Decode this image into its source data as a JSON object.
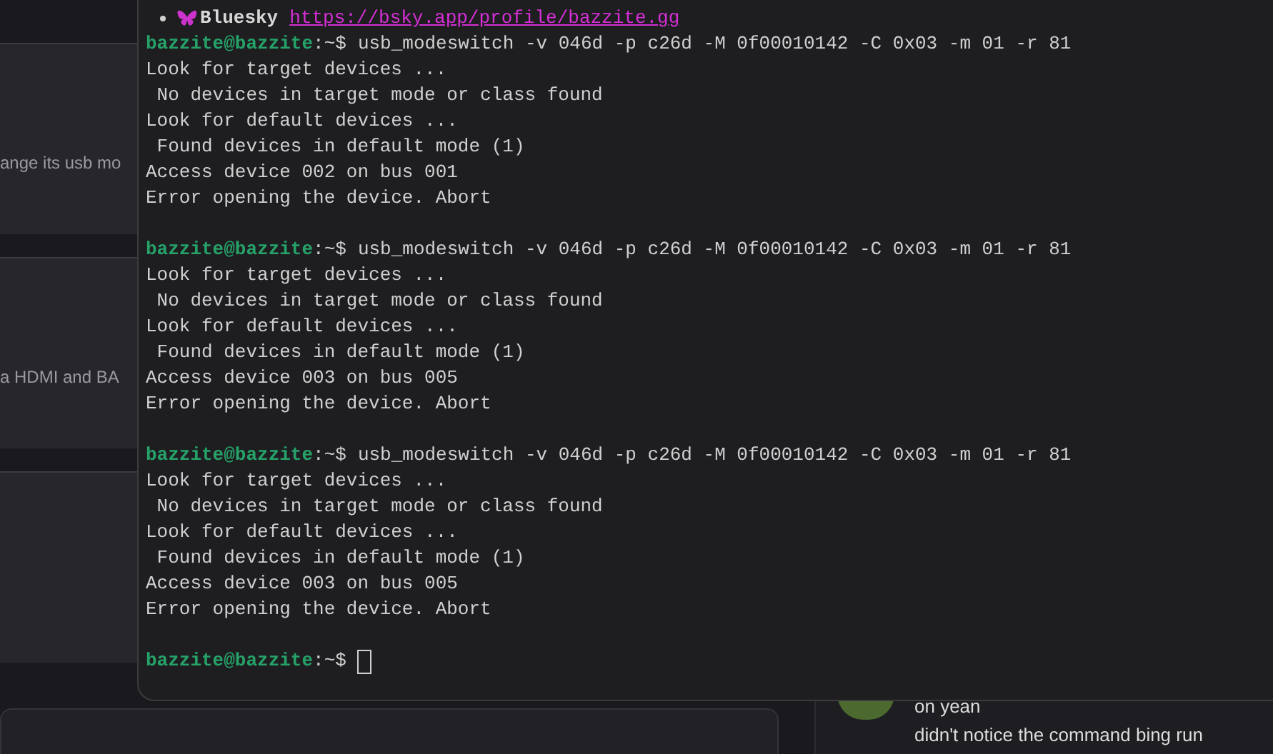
{
  "background_posts": [
    {
      "snippet": "ange its usb mo"
    },
    {
      "snippet": "a HDMI and BA"
    }
  ],
  "terminal": {
    "lines": [
      {
        "kind": "link_item",
        "label": "Bluesky",
        "url": "https://bsky.app/profile/bazzite.gg"
      },
      {
        "kind": "prompt",
        "user": "bazzite@bazzite",
        "path": ":~$",
        "command": "usb_modeswitch -v 046d -p c26d -M 0f00010142 -C 0x03 -m 01 -r 81"
      },
      {
        "kind": "output",
        "text": "Look for target devices ..."
      },
      {
        "kind": "output",
        "text": " No devices in target mode or class found"
      },
      {
        "kind": "output",
        "text": "Look for default devices ..."
      },
      {
        "kind": "output",
        "text": " Found devices in default mode (1)"
      },
      {
        "kind": "output",
        "text": "Access device 002 on bus 001"
      },
      {
        "kind": "output",
        "text": "Error opening the device. Abort"
      },
      {
        "kind": "blank"
      },
      {
        "kind": "prompt",
        "user": "bazzite@bazzite",
        "path": ":~$",
        "command": "usb_modeswitch -v 046d -p c26d -M 0f00010142 -C 0x03 -m 01 -r 81"
      },
      {
        "kind": "output",
        "text": "Look for target devices ..."
      },
      {
        "kind": "output",
        "text": " No devices in target mode or class found"
      },
      {
        "kind": "output",
        "text": "Look for default devices ..."
      },
      {
        "kind": "output",
        "text": " Found devices in default mode (1)"
      },
      {
        "kind": "output",
        "text": "Access device 003 on bus 005"
      },
      {
        "kind": "output",
        "text": "Error opening the device. Abort"
      },
      {
        "kind": "blank"
      },
      {
        "kind": "prompt",
        "user": "bazzite@bazzite",
        "path": ":~$",
        "command": "usb_modeswitch -v 046d -p c26d -M 0f00010142 -C 0x03 -m 01 -r 81"
      },
      {
        "kind": "output",
        "text": "Look for target devices ..."
      },
      {
        "kind": "output",
        "text": " No devices in target mode or class found"
      },
      {
        "kind": "output",
        "text": "Look for default devices ..."
      },
      {
        "kind": "output",
        "text": " Found devices in default mode (1)"
      },
      {
        "kind": "output",
        "text": "Access device 003 on bus 005"
      },
      {
        "kind": "output",
        "text": "Error opening the device. Abort"
      },
      {
        "kind": "blank"
      },
      {
        "kind": "cursor",
        "user": "bazzite@bazzite",
        "path": ":~$"
      }
    ]
  },
  "chat": {
    "messages": [
      {
        "text": "on yean"
      },
      {
        "text": "didn't notice the command bing run"
      }
    ]
  }
}
